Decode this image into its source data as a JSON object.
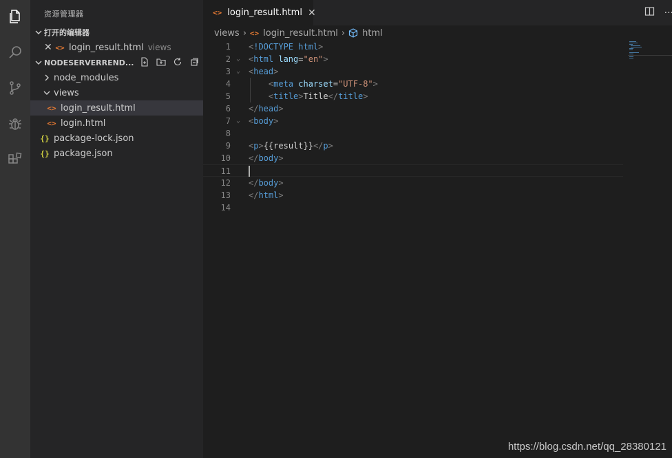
{
  "activity_bar": {
    "icons": [
      "explorer-icon",
      "search-icon",
      "source-control-icon",
      "debug-icon",
      "extensions-icon"
    ]
  },
  "sidebar": {
    "title": "资源管理器",
    "open_editors": {
      "header": "打开的编辑器",
      "items": [
        {
          "name": "login_result.html",
          "folder": "views"
        }
      ]
    },
    "folder": {
      "header": "NODESERVERREND...",
      "tree": [
        {
          "label": "node_modules",
          "kind": "folder",
          "expanded": false
        },
        {
          "label": "views",
          "kind": "folder",
          "expanded": true
        },
        {
          "label": "login_result.html",
          "kind": "html",
          "selected": true
        },
        {
          "label": "login.html",
          "kind": "html"
        },
        {
          "label": "package-lock.json",
          "kind": "json"
        },
        {
          "label": "package.json",
          "kind": "json"
        }
      ]
    }
  },
  "tabs": [
    {
      "label": "login_result.html",
      "active": true
    }
  ],
  "breadcrumb": {
    "folder": "views",
    "file": "login_result.html",
    "symbol": "html"
  },
  "editor": {
    "current_line": 11,
    "lines": [
      {
        "n": "1",
        "tokens": [
          [
            "t-punc",
            "<"
          ],
          [
            "t-tag",
            "!DOCTYPE html"
          ],
          [
            "t-punc",
            ">"
          ]
        ]
      },
      {
        "n": "2",
        "fold": true,
        "tokens": [
          [
            "t-punc",
            "<"
          ],
          [
            "t-tag",
            "html "
          ],
          [
            "t-attr",
            "lang"
          ],
          [
            "t-text",
            "="
          ],
          [
            "t-str",
            "\"en\""
          ],
          [
            "t-punc",
            ">"
          ]
        ]
      },
      {
        "n": "3",
        "fold": true,
        "tokens": [
          [
            "t-punc",
            "<"
          ],
          [
            "t-tag",
            "head"
          ],
          [
            "t-punc",
            ">"
          ]
        ]
      },
      {
        "n": "4",
        "tokens": [
          [
            "t-text",
            "    "
          ],
          [
            "t-punc",
            "<"
          ],
          [
            "t-tag",
            "meta "
          ],
          [
            "t-attr",
            "charset"
          ],
          [
            "t-text",
            "="
          ],
          [
            "t-str",
            "\"UTF-8\""
          ],
          [
            "t-punc",
            ">"
          ]
        ]
      },
      {
        "n": "5",
        "tokens": [
          [
            "t-text",
            "    "
          ],
          [
            "t-punc",
            "<"
          ],
          [
            "t-tag",
            "title"
          ],
          [
            "t-punc",
            ">"
          ],
          [
            "t-text",
            "Title"
          ],
          [
            "t-punc",
            "</"
          ],
          [
            "t-tag",
            "title"
          ],
          [
            "t-punc",
            ">"
          ]
        ]
      },
      {
        "n": "6",
        "tokens": [
          [
            "t-punc",
            "</"
          ],
          [
            "t-tag",
            "head"
          ],
          [
            "t-punc",
            ">"
          ]
        ]
      },
      {
        "n": "7",
        "fold": true,
        "tokens": [
          [
            "t-punc",
            "<"
          ],
          [
            "t-tag",
            "body"
          ],
          [
            "t-punc",
            ">"
          ]
        ]
      },
      {
        "n": "8",
        "tokens": []
      },
      {
        "n": "9",
        "tokens": [
          [
            "t-punc",
            "<"
          ],
          [
            "t-tag",
            "p"
          ],
          [
            "t-punc",
            ">"
          ],
          [
            "t-text",
            "{{result}}"
          ],
          [
            "t-punc",
            "</"
          ],
          [
            "t-tag",
            "p"
          ],
          [
            "t-punc",
            ">"
          ]
        ]
      },
      {
        "n": "10",
        "tokens": [
          [
            "t-punc",
            "</"
          ],
          [
            "t-tag",
            "body"
          ],
          [
            "t-punc",
            ">"
          ]
        ]
      },
      {
        "n": "11",
        "tokens": []
      },
      {
        "n": "12",
        "tokens": [
          [
            "t-punc",
            "</"
          ],
          [
            "t-tag",
            "body"
          ],
          [
            "t-punc",
            ">"
          ]
        ]
      },
      {
        "n": "13",
        "tokens": [
          [
            "t-punc",
            "</"
          ],
          [
            "t-tag",
            "html"
          ],
          [
            "t-punc",
            ">"
          ]
        ]
      },
      {
        "n": "14",
        "tokens": []
      }
    ]
  },
  "watermark": "https://blog.csdn.net/qq_28380121",
  "colors": {
    "activity_bar": "#333333",
    "sidebar": "#252526",
    "editor": "#1e1e1e",
    "tag": "#569cd6",
    "attribute": "#9cdcfe",
    "string": "#ce9178",
    "html_icon": "#e37933",
    "json_icon": "#cbcb41"
  }
}
